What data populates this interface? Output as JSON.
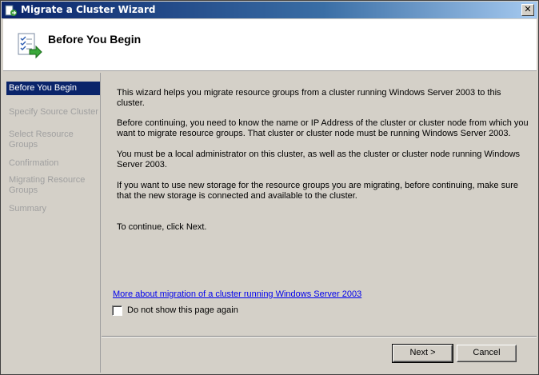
{
  "window": {
    "title": "Migrate a Cluster Wizard",
    "close_label": "✕"
  },
  "header": {
    "title": "Before You Begin"
  },
  "nav": {
    "items": [
      {
        "label": "Before You Begin",
        "active": true
      },
      {
        "label": "Specify Source Cluster",
        "active": false
      },
      {
        "label": "Select Resource Groups",
        "active": false
      },
      {
        "label": "Confirmation",
        "active": false
      },
      {
        "label": "Migrating Resource Groups",
        "active": false
      },
      {
        "label": "Summary",
        "active": false
      }
    ]
  },
  "content": {
    "paragraphs": [
      "This wizard helps you migrate resource groups from a cluster running Windows Server 2003 to this cluster.",
      "Before continuing, you need to know the name or IP Address of the cluster or cluster node from which you want to migrate resource groups. That cluster or cluster node must be running Windows Server 2003.",
      "You must be a local administrator on this cluster, as well as the cluster or cluster node running Windows Server 2003.",
      "If you want to use new storage for the resource groups you are migrating, before continuing, make sure that the new storage is connected and available to the cluster.",
      "To continue, click Next."
    ],
    "link": "More about migration of a cluster running Windows Server 2003",
    "checkbox_label": "Do not show this page again",
    "checkbox_checked": false
  },
  "buttons": {
    "next": "Next >",
    "cancel": "Cancel"
  }
}
